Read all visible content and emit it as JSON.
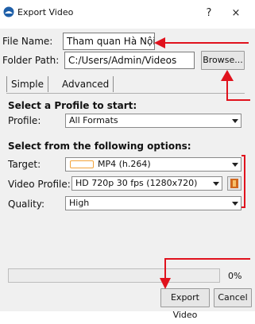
{
  "window": {
    "title": "Export Video",
    "help_label": "?",
    "close_label": "×"
  },
  "file_name": {
    "label": "File Name:",
    "value": "Tham quan Hà Nội"
  },
  "folder_path": {
    "label": "Folder Path:",
    "value": "C:/Users/Admin/Videos"
  },
  "browse_label": "Browse...",
  "tabs": [
    {
      "label": "Simple",
      "selected": true
    },
    {
      "label": "Advanced",
      "selected": false
    }
  ],
  "profile_section": {
    "title": "Select a Profile to start:",
    "profile_label": "Profile:",
    "profile_value": "All Formats"
  },
  "options_section": {
    "title": "Select from the following options:",
    "target_label": "Target:",
    "target_value": "MP4 (h.264)",
    "video_profile_label": "Video Profile:",
    "video_profile_value": "HD 720p 30 fps (1280x720)",
    "quality_label": "Quality:",
    "quality_value": "High"
  },
  "progress": {
    "percent_label": "0%",
    "value": 0
  },
  "buttons": {
    "export_label": "Export Video",
    "cancel_label": "Cancel"
  },
  "colors": {
    "annotation": "#e0121d",
    "accent": "#f2a33a"
  }
}
